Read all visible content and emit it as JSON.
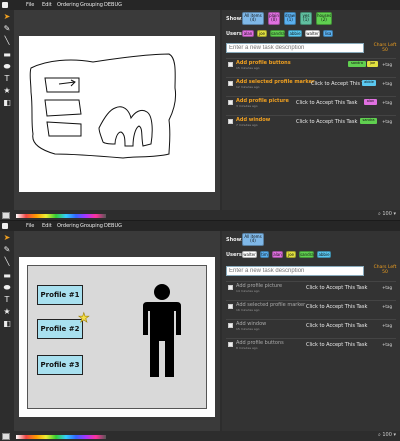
{
  "menu": [
    "File",
    "Edit",
    "Ordering",
    "Grouping",
    "DEBUG"
  ],
  "tools": [
    "pointer-icon",
    "pencil-icon",
    "line-icon",
    "rectangle-icon",
    "ellipse-icon",
    "text-icon",
    "star-icon",
    "color-swatch-icon"
  ],
  "tool_glyphs": [
    "➤",
    "✎",
    "╲",
    "▬",
    "⬬",
    "T",
    "★",
    "◧"
  ],
  "panel1": {
    "show_label": "Show:",
    "filters": [
      {
        "label": "All items",
        "count": "(4)",
        "color": "#7fb8e8"
      },
      {
        "label": "plain",
        "count": "(0)",
        "color": "#e070e0"
      },
      {
        "label": "draw",
        "count": "(1)",
        "color": "#5ab0f0"
      },
      {
        "label": "yes",
        "count": "(1)",
        "color": "#60c0a0"
      },
      {
        "label": "houses",
        "count": "(2)",
        "color": "#60d050"
      }
    ],
    "users_label": "Users:",
    "users": [
      {
        "name": "alan",
        "color": "#e070e0"
      },
      {
        "name": "joe",
        "color": "#e0e040"
      },
      {
        "name": "sandra",
        "color": "#60d050"
      },
      {
        "name": "abbie",
        "color": "#5ac8f0"
      },
      {
        "name": "walter",
        "color": "#ffffff"
      },
      {
        "name": "lisa",
        "color": "#5ab0f0"
      }
    ],
    "input_placeholder": "Enter a new task description",
    "chars_label": "Chars Left",
    "chars_value": "50",
    "tasks": [
      {
        "name": "Add profile buttons",
        "age": "15 minutes ago",
        "accept": "",
        "tags": [
          {
            "name": "sandra",
            "color": "#60d050"
          },
          {
            "name": "joe",
            "color": "#e0e040"
          }
        ],
        "tag_btn": "+tag"
      },
      {
        "name": "Add selected profile marker",
        "age": "12 minutes ago",
        "accept": "Click to Accept This Task",
        "tags": [
          {
            "name": "abbie",
            "color": "#5ac8f0"
          }
        ],
        "tag_btn": "+tag"
      },
      {
        "name": "Add profile picture",
        "age": "3 minutes ago",
        "accept": "Click to Accept This Task",
        "tags": [
          {
            "name": "alan",
            "color": "#e070e0"
          }
        ],
        "tag_btn": "+tag"
      },
      {
        "name": "Add window",
        "age": "7 minutes ago",
        "accept": "Click to Accept This Task",
        "tags": [
          {
            "name": "sandra",
            "color": "#60d050"
          }
        ],
        "tag_btn": "+tag"
      }
    ],
    "zoom": "100"
  },
  "panel2": {
    "show_label": "Show:",
    "filters": [
      {
        "label": "All items",
        "count": "(4)",
        "color": "#7fb8e8"
      }
    ],
    "users_label": "Users:",
    "users": [
      {
        "name": "walter",
        "color": "#ffffff"
      },
      {
        "name": "tim",
        "color": "#5ab0f0"
      },
      {
        "name": "alan",
        "color": "#e070e0"
      },
      {
        "name": "joe",
        "color": "#e0e040"
      },
      {
        "name": "sandra",
        "color": "#60d050"
      },
      {
        "name": "abbie",
        "color": "#5ac8f0"
      }
    ],
    "input_placeholder": "Enter a new task description",
    "chars_label": "Chars Left",
    "chars_value": "50",
    "tasks": [
      {
        "name": "Add profile picture",
        "age": "14 minutes ago",
        "accept": "Click to Accept This Task",
        "tag_btn": "+tag"
      },
      {
        "name": "Add selected profile marker",
        "age": "16 minutes ago",
        "accept": "Click to Accept This Task",
        "tag_btn": "+tag"
      },
      {
        "name": "Add window",
        "age": "15 minutes ago",
        "accept": "Click to Accept This Task",
        "tag_btn": "+tag"
      },
      {
        "name": "Add profile buttons",
        "age": "8 minutes ago",
        "accept": "Click to Accept This Task",
        "tag_btn": "+tag"
      }
    ],
    "profiles": [
      "Profile #1",
      "Profile #2",
      "Profile #3"
    ],
    "zoom": "100"
  }
}
